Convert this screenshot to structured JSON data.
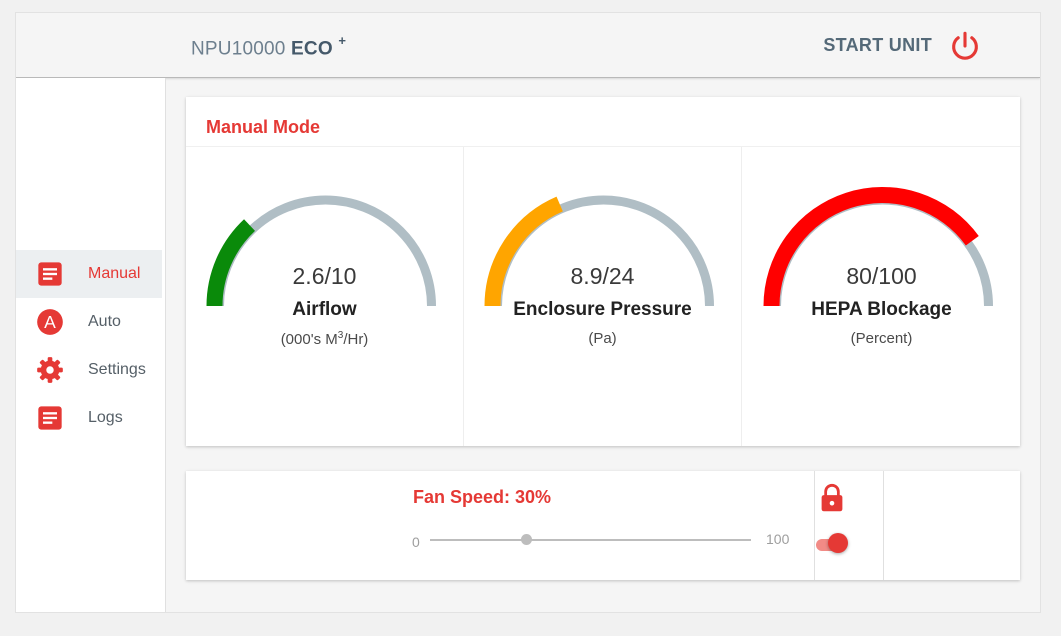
{
  "header": {
    "model": "NPU10000",
    "edition": "ECO",
    "edition_sup": "+",
    "start_label": "START UNIT",
    "power_icon": "power-icon",
    "accent_color": "#e53935"
  },
  "sidebar": {
    "items": [
      {
        "label": "Manual",
        "icon": "document-icon",
        "active": true
      },
      {
        "label": "Auto",
        "icon": "auto-a-icon",
        "active": false
      },
      {
        "label": "Settings",
        "icon": "gear-icon",
        "active": false
      },
      {
        "label": "Logs",
        "icon": "document-icon",
        "active": false
      }
    ]
  },
  "manual": {
    "title": "Manual Mode",
    "gauges": [
      {
        "value": 2.6,
        "max": 10,
        "display": "2.6/10",
        "label": "Airflow",
        "unit_pre": "(000's M",
        "unit_sup": "3",
        "unit_post": "/Hr)",
        "color": "#0a8a0a"
      },
      {
        "value": 8.9,
        "max": 24,
        "display": "8.9/24",
        "label": "Enclosure Pressure",
        "unit": "(Pa)",
        "color": "#ffa500"
      },
      {
        "value": 80,
        "max": 100,
        "display": "80/100",
        "label": "HEPA Blockage",
        "unit": "(Percent)",
        "color": "#ff0000"
      }
    ],
    "track_color": "#b0bec5"
  },
  "fan": {
    "label": "Fan Speed: 30%",
    "value": 30,
    "min": "0",
    "max": "100",
    "lock_icon": "lock-icon",
    "toggle_on": true
  }
}
